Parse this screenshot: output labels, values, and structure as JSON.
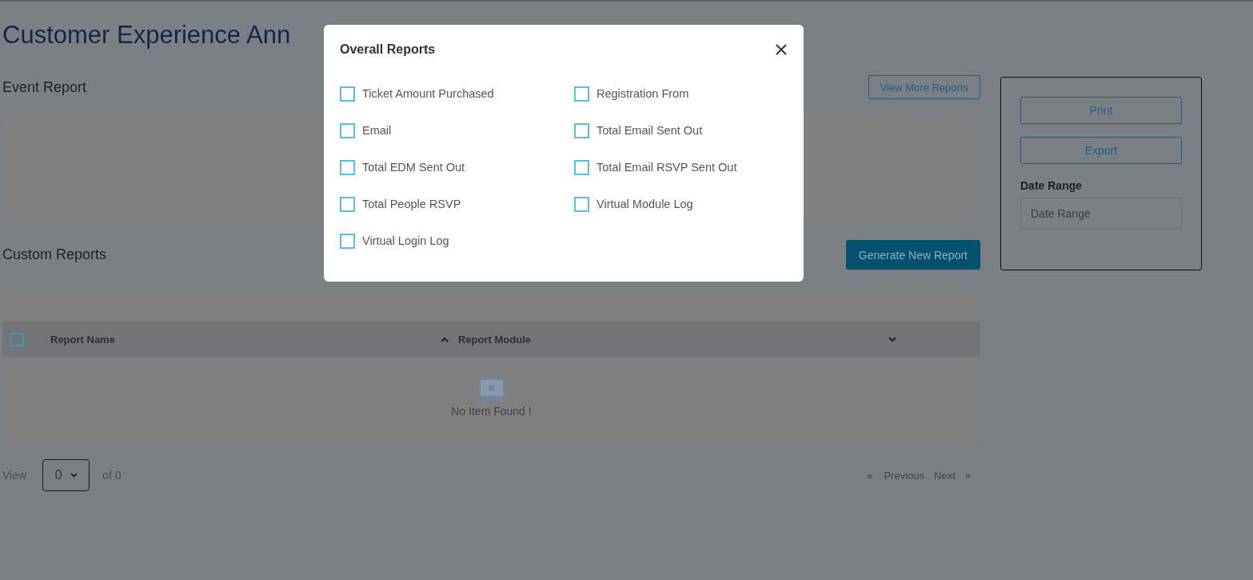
{
  "page": {
    "title": "Customer Experience Ann"
  },
  "event_report": {
    "heading": "Event Report",
    "button": "View More Reports"
  },
  "custom_reports": {
    "heading": "Custom Reports",
    "button": "Generate New Report",
    "table": {
      "select_all_checked": false,
      "columns": [
        "Report Name",
        "Report Module"
      ],
      "empty_message": "No Item Found !"
    }
  },
  "pagination": {
    "view_label": "View",
    "page_size": "0",
    "of_label": "of 0",
    "prev_mark": "«",
    "previous": "Previous",
    "next": "Next",
    "next_mark": "»"
  },
  "side_panel": {
    "print": "Print",
    "export": "Export",
    "date_range_label": "Date Range",
    "date_range_placeholder": "Date Range"
  },
  "modal": {
    "title": "Overall Reports",
    "options": [
      {
        "label": "Ticket Amount Purchased",
        "checked": false
      },
      {
        "label": "Registration From",
        "checked": false
      },
      {
        "label": "Email",
        "checked": false
      },
      {
        "label": "Total Email Sent Out",
        "checked": false
      },
      {
        "label": "Total EDM Sent Out",
        "checked": false
      },
      {
        "label": "Total Email RSVP Sent Out",
        "checked": false
      },
      {
        "label": "Total People RSVP",
        "checked": false
      },
      {
        "label": "Virtual Module Log",
        "checked": false
      },
      {
        "label": "Virtual Login Log",
        "checked": false
      }
    ]
  }
}
